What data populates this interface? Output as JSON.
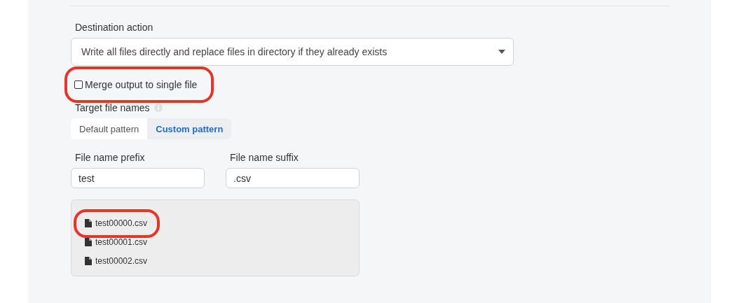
{
  "destination": {
    "label": "Destination action",
    "value": "Write all files directly and replace files in directory if they already exists"
  },
  "merge": {
    "label": "Merge output to single file",
    "checked": false,
    "highlighted": true
  },
  "target": {
    "label": "Target file names",
    "tabs": [
      {
        "label": "Default pattern",
        "selected": false
      },
      {
        "label": "Custom pattern",
        "selected": true
      }
    ]
  },
  "fields": [
    {
      "label": "File name prefix",
      "value": "test"
    },
    {
      "label": "File name suffix",
      "value": ".csv"
    }
  ],
  "files": [
    {
      "name": "test00000.csv",
      "highlighted": true
    },
    {
      "name": "test00001.csv",
      "highlighted": false
    },
    {
      "name": "test00002.csv",
      "highlighted": false
    }
  ]
}
